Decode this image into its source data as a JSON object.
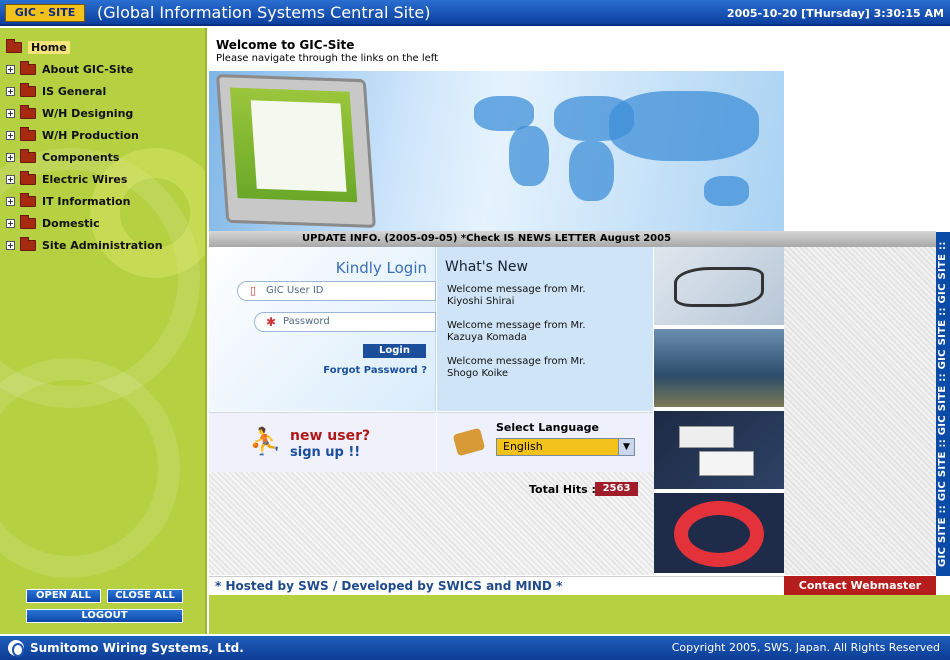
{
  "header": {
    "badge": "GIC - SITE",
    "title": "(Global Information Systems Central Site)",
    "datetime": "2005-10-20 [THursday] 3:30:15 AM"
  },
  "sidebar": {
    "items": [
      {
        "label": "Home",
        "icon": "folder-open-icon"
      },
      {
        "label": "About GIC-Site",
        "icon": "folder-icon"
      },
      {
        "label": "IS General",
        "icon": "folder-icon"
      },
      {
        "label": "W/H Designing",
        "icon": "folder-icon"
      },
      {
        "label": "W/H Production",
        "icon": "folder-icon"
      },
      {
        "label": "Components",
        "icon": "folder-icon"
      },
      {
        "label": "Electric Wires",
        "icon": "folder-icon"
      },
      {
        "label": "IT Information",
        "icon": "folder-icon"
      },
      {
        "label": "Domestic",
        "icon": "folder-icon"
      },
      {
        "label": "Site Administration",
        "icon": "folder-icon"
      }
    ],
    "open_all": "OPEN ALL",
    "close_all": "CLOSE ALL",
    "logout": "LOGOUT"
  },
  "welcome": {
    "title": "Welcome to GIC-Site",
    "subtitle": "Please navigate through the links on the left"
  },
  "update_bar": "UPDATE INFO. (2005-09-05) *Check IS NEWS LETTER August 2005",
  "login": {
    "heading": "Kindly Login",
    "user_placeholder": "GIC User ID",
    "password_placeholder": "Password",
    "login_button": "Login",
    "forgot": "Forgot Password ?"
  },
  "news": {
    "title": "What's New",
    "messages": [
      {
        "line1": "Welcome message from Mr.",
        "line2": "Kiyoshi Shirai"
      },
      {
        "line1": "Welcome message from Mr.",
        "line2": "Kazuya Komada"
      },
      {
        "line1": "Welcome message from Mr.",
        "line2": "Shogo Koike"
      }
    ]
  },
  "signup": {
    "line1": "new user?",
    "line2": "sign up !!"
  },
  "language": {
    "label": "Select Language",
    "selected": "English"
  },
  "hits": {
    "label": "Total Hits :",
    "value": "2563"
  },
  "side_banner": "GIC SITE :: GIC SITE :: GIC SITE :: GIC SITE :: GIC SITE :: GIC SITE",
  "hosted": "* Hosted by SWS / Developed by SWICS and MIND *",
  "contact": "Contact Webmaster",
  "footer": {
    "company": "Sumitomo Wiring Systems, Ltd.",
    "copyright": "Copyright 2005, SWS, Japan. All Rights Reserved"
  },
  "colors": {
    "header_blue": "#0c3f9e",
    "sidebar_green": "#b5d040",
    "badge_yellow": "#f2c21b",
    "hits_red": "#a01c2a",
    "contact_red": "#b61e1e"
  }
}
